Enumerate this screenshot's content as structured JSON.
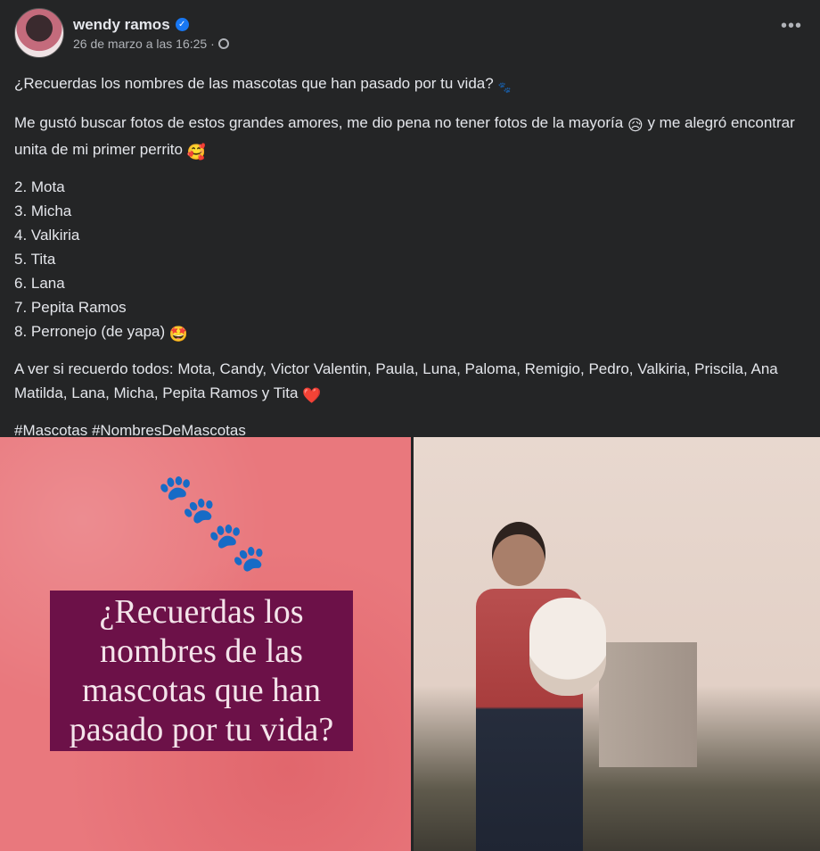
{
  "post": {
    "author": "wendy ramos",
    "timestamp": "26 de marzo a las 16:25 ·",
    "more_label": "•••",
    "intro": "¿Recuerdas los nombres de las mascotas que han pasado por tu vida?",
    "body": "Me gustó buscar fotos de estos grandes amores, me dio pena no tener fotos de la mayoría",
    "body_mid": "y me alegró encontrar unita de mi primer perrito",
    "list": [
      "2. Mota",
      "3. Micha",
      "4. Valkiria",
      "5. Tita",
      "6. Lana",
      "7. Pepita Ramos",
      "8. Perronejo (de yapa)"
    ],
    "recall": "A ver si recuerdo todos: Mota, Candy, Victor Valentin, Paula, Luna, Paloma, Remigio, Pedro, Valkiria, Priscila, Ana Matilda, Lana, Micha, Pepita Ramos y Tita",
    "hashtags": [
      "#Mascotas",
      "#NombresDeMascotas"
    ],
    "photo_caption": "¿Recuerdas los nombres de las mascotas que han pasado por tu vida?",
    "icons": {
      "verified": "check",
      "globe": "globe-icon",
      "paw": "🐾",
      "sad": "😥",
      "love": "🥰",
      "star_eyes": "🤩",
      "heart": "❤️",
      "paws_small": "🐾"
    }
  }
}
